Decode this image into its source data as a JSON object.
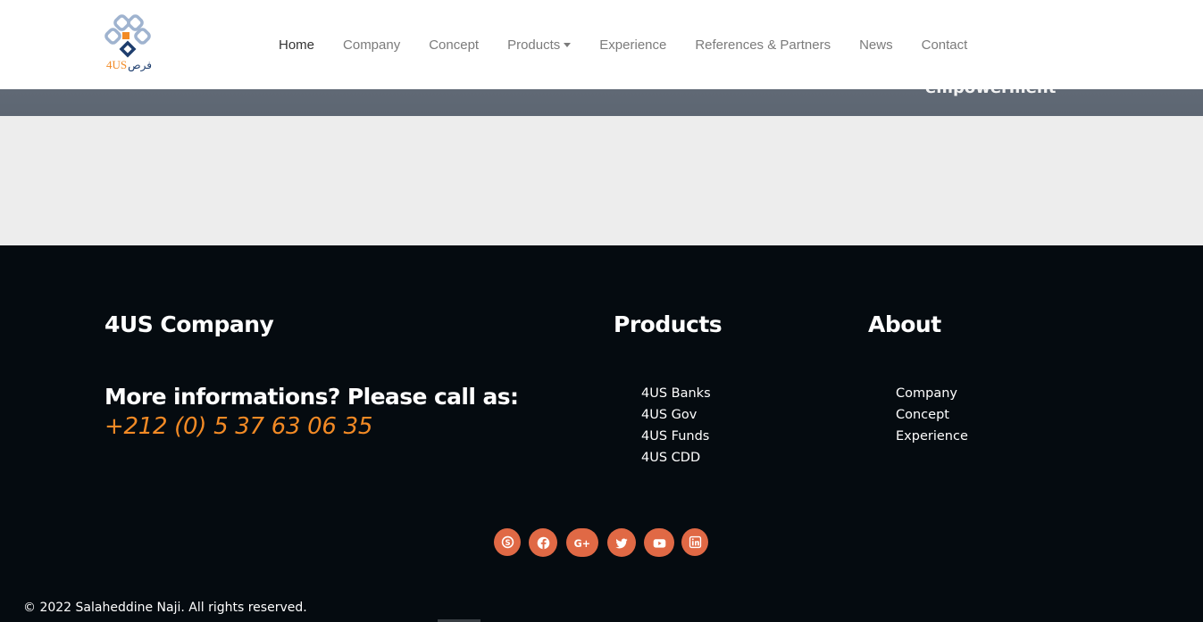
{
  "hero": {
    "text": "empowerment"
  },
  "brand": {
    "logo_text": "4US",
    "logo_arabic": "فرص"
  },
  "nav": {
    "items": [
      {
        "label": "Home",
        "active": true
      },
      {
        "label": "Company"
      },
      {
        "label": "Concept"
      },
      {
        "label": "Products",
        "dropdown": true
      },
      {
        "label": "Experience"
      },
      {
        "label": "References & Partners"
      },
      {
        "label": "News"
      },
      {
        "label": "Contact"
      }
    ]
  },
  "footer": {
    "company_title": "4US Company",
    "call_text": "More informations? Please call as:",
    "phone": "+212 (0) 5 37 63 06 35",
    "products_title": "Products",
    "products": [
      "4US Banks",
      "4US Gov",
      "4US Funds",
      "4US CDD"
    ],
    "about_title": "About",
    "about": [
      "Company",
      "Concept",
      "Experience"
    ],
    "socials": [
      "skype-icon",
      "facebook-icon",
      "google-plus-icon",
      "twitter-icon",
      "youtube-icon",
      "linkedin-icon"
    ],
    "copyright": "© 2022 Salaheddine Naji. All rights reserved."
  },
  "colors": {
    "accent_orange": "#f28a25",
    "social_bg": "#e06945",
    "footer_bg": "#050b10",
    "logo_blue": "#9fb3cf",
    "logo_dark": "#1e3e6e"
  }
}
